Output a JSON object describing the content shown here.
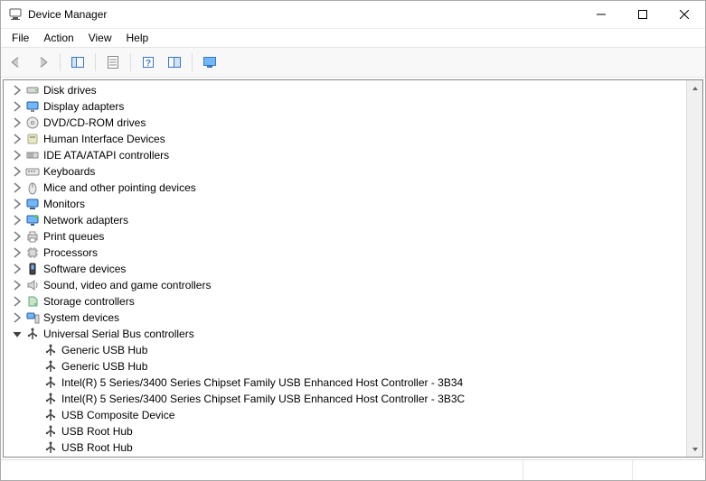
{
  "window": {
    "title": "Device Manager"
  },
  "menu": {
    "file": "File",
    "action": "Action",
    "view": "View",
    "help": "Help"
  },
  "tree": {
    "nodes": [
      {
        "label": "Disk drives",
        "icon": "disk",
        "depth": 1,
        "toggle": "right"
      },
      {
        "label": "Display adapters",
        "icon": "display",
        "depth": 1,
        "toggle": "right"
      },
      {
        "label": "DVD/CD-ROM drives",
        "icon": "dvd",
        "depth": 1,
        "toggle": "right"
      },
      {
        "label": "Human Interface Devices",
        "icon": "hid",
        "depth": 1,
        "toggle": "right"
      },
      {
        "label": "IDE ATA/ATAPI controllers",
        "icon": "ide",
        "depth": 1,
        "toggle": "right"
      },
      {
        "label": "Keyboards",
        "icon": "keyboard",
        "depth": 1,
        "toggle": "right"
      },
      {
        "label": "Mice and other pointing devices",
        "icon": "mouse",
        "depth": 1,
        "toggle": "right"
      },
      {
        "label": "Monitors",
        "icon": "monitor",
        "depth": 1,
        "toggle": "right"
      },
      {
        "label": "Network adapters",
        "icon": "network",
        "depth": 1,
        "toggle": "right"
      },
      {
        "label": "Print queues",
        "icon": "printer",
        "depth": 1,
        "toggle": "right"
      },
      {
        "label": "Processors",
        "icon": "cpu",
        "depth": 1,
        "toggle": "right"
      },
      {
        "label": "Software devices",
        "icon": "software",
        "depth": 1,
        "toggle": "right"
      },
      {
        "label": "Sound, video and game controllers",
        "icon": "sound",
        "depth": 1,
        "toggle": "right"
      },
      {
        "label": "Storage controllers",
        "icon": "storage",
        "depth": 1,
        "toggle": "right"
      },
      {
        "label": "System devices",
        "icon": "system",
        "depth": 1,
        "toggle": "right"
      },
      {
        "label": "Universal Serial Bus controllers",
        "icon": "usb",
        "depth": 1,
        "toggle": "down"
      },
      {
        "label": "Generic USB Hub",
        "icon": "usb",
        "depth": 2,
        "toggle": "none"
      },
      {
        "label": "Generic USB Hub",
        "icon": "usb",
        "depth": 2,
        "toggle": "none"
      },
      {
        "label": "Intel(R) 5 Series/3400 Series Chipset Family USB Enhanced Host Controller - 3B34",
        "icon": "usb",
        "depth": 2,
        "toggle": "none"
      },
      {
        "label": "Intel(R) 5 Series/3400 Series Chipset Family USB Enhanced Host Controller - 3B3C",
        "icon": "usb",
        "depth": 2,
        "toggle": "none"
      },
      {
        "label": "USB Composite Device",
        "icon": "usb",
        "depth": 2,
        "toggle": "none"
      },
      {
        "label": "USB Root Hub",
        "icon": "usb",
        "depth": 2,
        "toggle": "none"
      },
      {
        "label": "USB Root Hub",
        "icon": "usb",
        "depth": 2,
        "toggle": "none"
      }
    ]
  }
}
